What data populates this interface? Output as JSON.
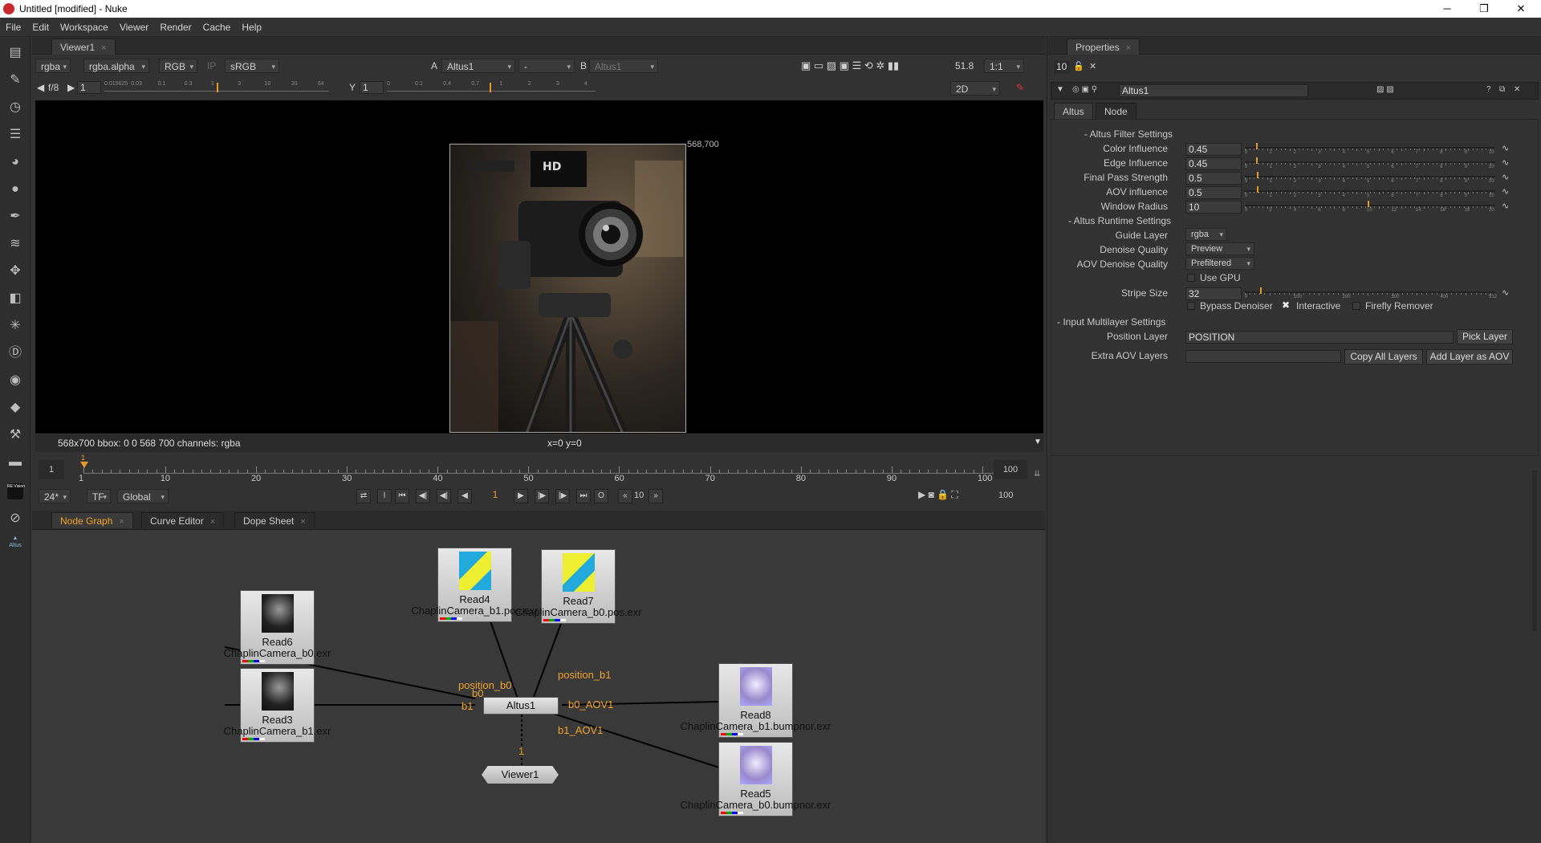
{
  "window": {
    "title": "Untitled [modified] - Nuke"
  },
  "menu": [
    "File",
    "Edit",
    "Workspace",
    "Viewer",
    "Render",
    "Cache",
    "Help"
  ],
  "left_tools": [
    "viewer-tool-icon",
    "paint-brush-icon",
    "clock-icon",
    "channel-icon",
    "color-wheel-icon",
    "circle-icon",
    "pen-icon",
    "layers-icon",
    "transform-icon",
    "cube-icon",
    "particles-icon",
    "d-icon",
    "eye-icon",
    "keyer-icon",
    "wrench-icon",
    "drive-icon",
    "revision-icon",
    "loop-icon",
    "altus-icon"
  ],
  "altus_tool_label": "Altus",
  "re_vision_label": "RE:Vision",
  "viewer": {
    "tab": "Viewer1",
    "channels": "rgba",
    "alpha": "rgba.alpha",
    "display": "RGB",
    "ip": "IP",
    "lut": "sRGB",
    "a_label": "A",
    "a_input": "Altus1",
    "dash": "-",
    "b_label": "B",
    "b_input": "Altus1",
    "zoom": "51.8",
    "ratio": "1:1",
    "fstop": "f/8",
    "gain": "1",
    "gamma_label": "Y",
    "gamma": "1",
    "view_mode": "2D",
    "gain_ticks": [
      "0.015625",
      "0.03",
      "0.1",
      "0.3",
      "1",
      "3",
      "10",
      "30",
      "64"
    ],
    "gamma_ticks": [
      "0",
      "0.1",
      "0.4",
      "0.7",
      "1",
      "2",
      "3",
      "4"
    ],
    "res_label": "568,700",
    "status_left": "568x700  bbox: 0 0 568 700 channels: rgba",
    "status_mid": "x=0 y=0"
  },
  "timeline": {
    "start": "1",
    "end": "100",
    "ticks": [
      "1",
      "10",
      "20",
      "30",
      "40",
      "50",
      "60",
      "70",
      "80",
      "90",
      "100"
    ],
    "current_frame": "1",
    "fps": "24*",
    "tf": "TF",
    "global": "Global",
    "frame_field": "1",
    "skip": "10",
    "end_field": "100"
  },
  "graph_tabs": [
    {
      "label": "Node Graph",
      "x": "×"
    },
    {
      "label": "Curve Editor",
      "x": "×"
    },
    {
      "label": "Dope Sheet",
      "x": "×"
    }
  ],
  "nodes": {
    "read6": {
      "name": "Read6",
      "file": "ChaplinCamera_b0.exr"
    },
    "read3": {
      "name": "Read3",
      "file": "ChaplinCamera_b1.exr"
    },
    "read4": {
      "name": "Read4",
      "file": "ChaplinCamera_b1.pos.exr"
    },
    "read7": {
      "name": "Read7",
      "file": "ChaplinCamera_b0.pos.exr"
    },
    "read8": {
      "name": "Read8",
      "file": "ChaplinCamera_b1.bumpnor.exr"
    },
    "read5": {
      "name": "Read5",
      "file": "ChaplinCamera_b0.bumpnor.exr"
    },
    "altus": {
      "name": "Altus1"
    },
    "viewer": {
      "name": "Viewer1"
    }
  },
  "edges": {
    "position_b0": "position_b0",
    "position_b1": "position_b1",
    "b0": "b0",
    "b1": "b1",
    "b0_aov": "b0_AOV1",
    "b1_aov": "b1_AOV1",
    "viewer_input": "1"
  },
  "properties": {
    "tab": "Properties",
    "count": "10",
    "node_name": "Altus1",
    "tabs": [
      "Altus",
      "Node"
    ],
    "section_filter": "- Altus Filter Settings",
    "section_runtime": "- Altus Runtime Settings",
    "section_input": "- Input Multilayer Settings",
    "color_influence_label": "Color Influence",
    "color_influence": "0.45",
    "edge_influence_label": "Edge Influence",
    "edge_influence": "0.45",
    "final_pass_label": "Final Pass Strength",
    "final_pass": "0.5",
    "aov_influence_label": "AOV influence",
    "aov_influence": "0.5",
    "window_radius_label": "Window Radius",
    "window_radius": "10",
    "guide_layer_label": "Guide Layer",
    "guide_layer": "rgba",
    "denoise_quality_label": "Denoise Quality",
    "denoise_quality": "Preview",
    "aov_denoise_label": "AOV Denoise Quality",
    "aov_denoise": "Prefiltered",
    "use_gpu": "Use GPU",
    "stripe_size_label": "Stripe Size",
    "stripe_size": "32",
    "bypass": "Bypass Denoiser",
    "interactive": "Interactive",
    "firefly": "Firefly Remover",
    "position_layer_label": "Position Layer",
    "position_layer": "POSITION",
    "pick_layer": "Pick Layer",
    "extra_aov_label": "Extra AOV Layers",
    "copy_all": "Copy All Layers",
    "add_layer": "Add Layer as AOV",
    "slider_ticks_10": [
      "0",
      "1",
      "2",
      "3",
      "4",
      "5",
      "6",
      "7",
      "8",
      "9",
      "10"
    ],
    "slider_ticks_20": [
      "0",
      "2",
      "4",
      "6",
      "8",
      "10",
      "12",
      "14",
      "16",
      "18",
      "20"
    ],
    "slider_ticks_stripe": [
      "0",
      "100",
      "200",
      "300",
      "400",
      "512"
    ]
  }
}
